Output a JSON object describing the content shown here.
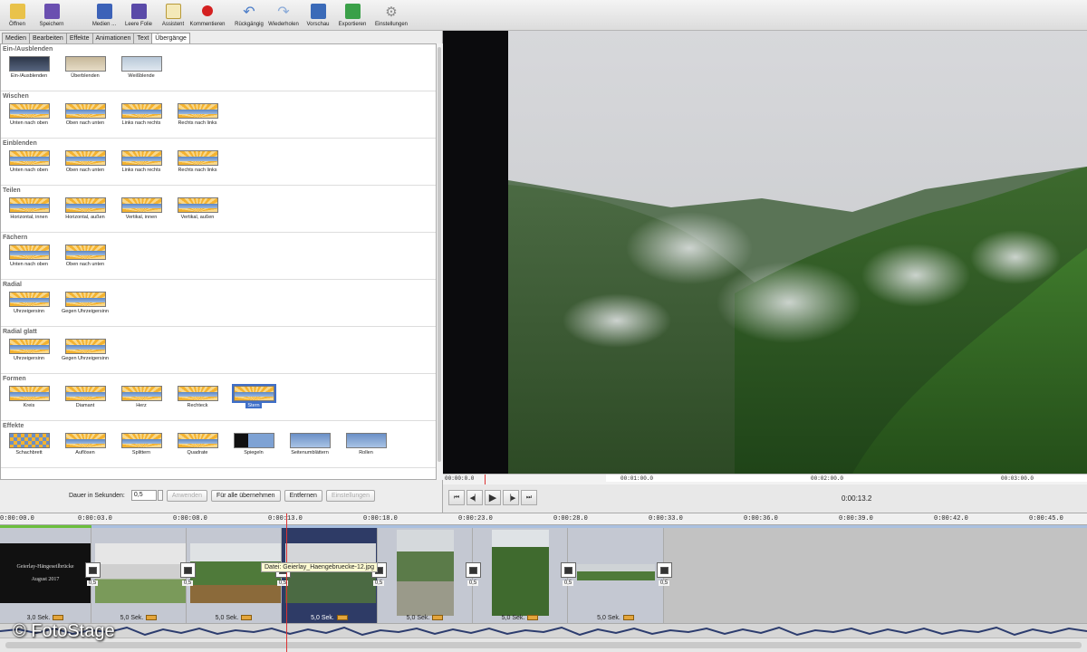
{
  "toolbar": {
    "buttons": [
      {
        "label": "Öffnen",
        "icon": "folder-icon",
        "color": "#e9c24a"
      },
      {
        "label": "Speichern",
        "icon": "save-icon",
        "color": "#6a4fb0"
      },
      {
        "label": "Medien ...",
        "icon": "media-icon",
        "color": "#3c62b8"
      },
      {
        "label": "Leere Folie",
        "icon": "slide-icon",
        "color": "#5a4aa8"
      },
      {
        "label": "Assistent",
        "icon": "wizard-icon",
        "color": "#d9b24a"
      },
      {
        "label": "Kommentieren",
        "icon": "record-icon",
        "color": "#d42020"
      },
      {
        "label": "Rückgängig",
        "icon": "undo-icon",
        "color": "#4a7cc8"
      },
      {
        "label": "Wiederholen",
        "icon": "redo-icon",
        "color": "#8aaad8"
      },
      {
        "label": "Vorschau",
        "icon": "preview-icon",
        "color": "#3a6ab8"
      },
      {
        "label": "Exportieren",
        "icon": "export-icon",
        "color": "#3aa048"
      },
      {
        "label": "Einstellungen",
        "icon": "gear-icon",
        "color": "#8a8a8a"
      }
    ]
  },
  "tabs": [
    "Medien",
    "Bearbeiten",
    "Effekte",
    "Animationen",
    "Text",
    "Übergänge"
  ],
  "sections": [
    {
      "title": "Ein-/Ausblenden",
      "items": [
        "Ein-/Ausblenden",
        "Überblenden",
        "Weißblende"
      ]
    },
    {
      "title": "Wischen",
      "items": [
        "Unten nach oben",
        "Oben nach unten",
        "Links nach rechts",
        "Rechts nach links"
      ]
    },
    {
      "title": "Einblenden",
      "items": [
        "Unten nach oben",
        "Oben nach unten",
        "Links nach rechts",
        "Rechts nach links"
      ]
    },
    {
      "title": "Teilen",
      "items": [
        "Horizontal, innen",
        "Horizontal, außen",
        "Vertikal, innen",
        "Vertikal, außen"
      ]
    },
    {
      "title": "Fächern",
      "items": [
        "Unten nach oben",
        "Oben nach unten"
      ]
    },
    {
      "title": "Radial",
      "items": [
        "Uhrzeigersinn",
        "Gegen Uhrzeigersinn"
      ]
    },
    {
      "title": "Radial glatt",
      "items": [
        "Uhrzeigersinn",
        "Gegen Uhrzeigersinn"
      ]
    },
    {
      "title": "Formen",
      "items": [
        "Kreis",
        "Diamant",
        "Herz",
        "Rechteck",
        "Stern"
      ]
    },
    {
      "title": "Effekte",
      "items": [
        "Schachbrett",
        "Auflösen",
        "Splittern",
        "Quadrate",
        "Spiegeln",
        "Seitenumblättern",
        "Rollen"
      ]
    }
  ],
  "selected_transition": "Stern",
  "duration": {
    "label": "Dauer in Sekunden:",
    "value": "0,5",
    "buttons": {
      "apply": "Anwenden",
      "apply_all": "Für alle übernehmen",
      "remove": "Entfernen",
      "settings": "Einstellungen"
    }
  },
  "preview": {
    "ruler": [
      "00:00:0.0",
      "00:01:00.0",
      "00:02:00.0",
      "00:03:00.0"
    ],
    "time": "0:00:13.2"
  },
  "timeline": {
    "ruler": [
      "0:00:00.0",
      "0:00:03.0",
      "0:00:08.0",
      "0:00:13.0",
      "0:00:18.0",
      "0:00:23.0",
      "0:00:28.0",
      "0:00:33.0",
      "0:00:36.0",
      "0:00:39.0",
      "0:00:42.0",
      "0:00:45.0"
    ],
    "title_clip_line1": "Geierlay-Hängeseilbrücke",
    "title_clip_line2": "August 2017",
    "clips": [
      {
        "duration": "3,0 Sek."
      },
      {
        "duration": "5,0 Sek."
      },
      {
        "duration": "5,0 Sek."
      },
      {
        "duration": "5,0 Sek."
      },
      {
        "duration": "5,0 Sek."
      },
      {
        "duration": "5,0 Sek."
      },
      {
        "duration": "5,0 Sek."
      }
    ],
    "transition_value": "0,5",
    "tooltip": "Datei: Geierlay_Haengebruecke-12.jpg"
  },
  "watermark": "© FotoStage",
  "colors": {
    "selection": "#3f6fc8",
    "playhead": "#d33333",
    "accent_green": "#6bbf3c"
  }
}
